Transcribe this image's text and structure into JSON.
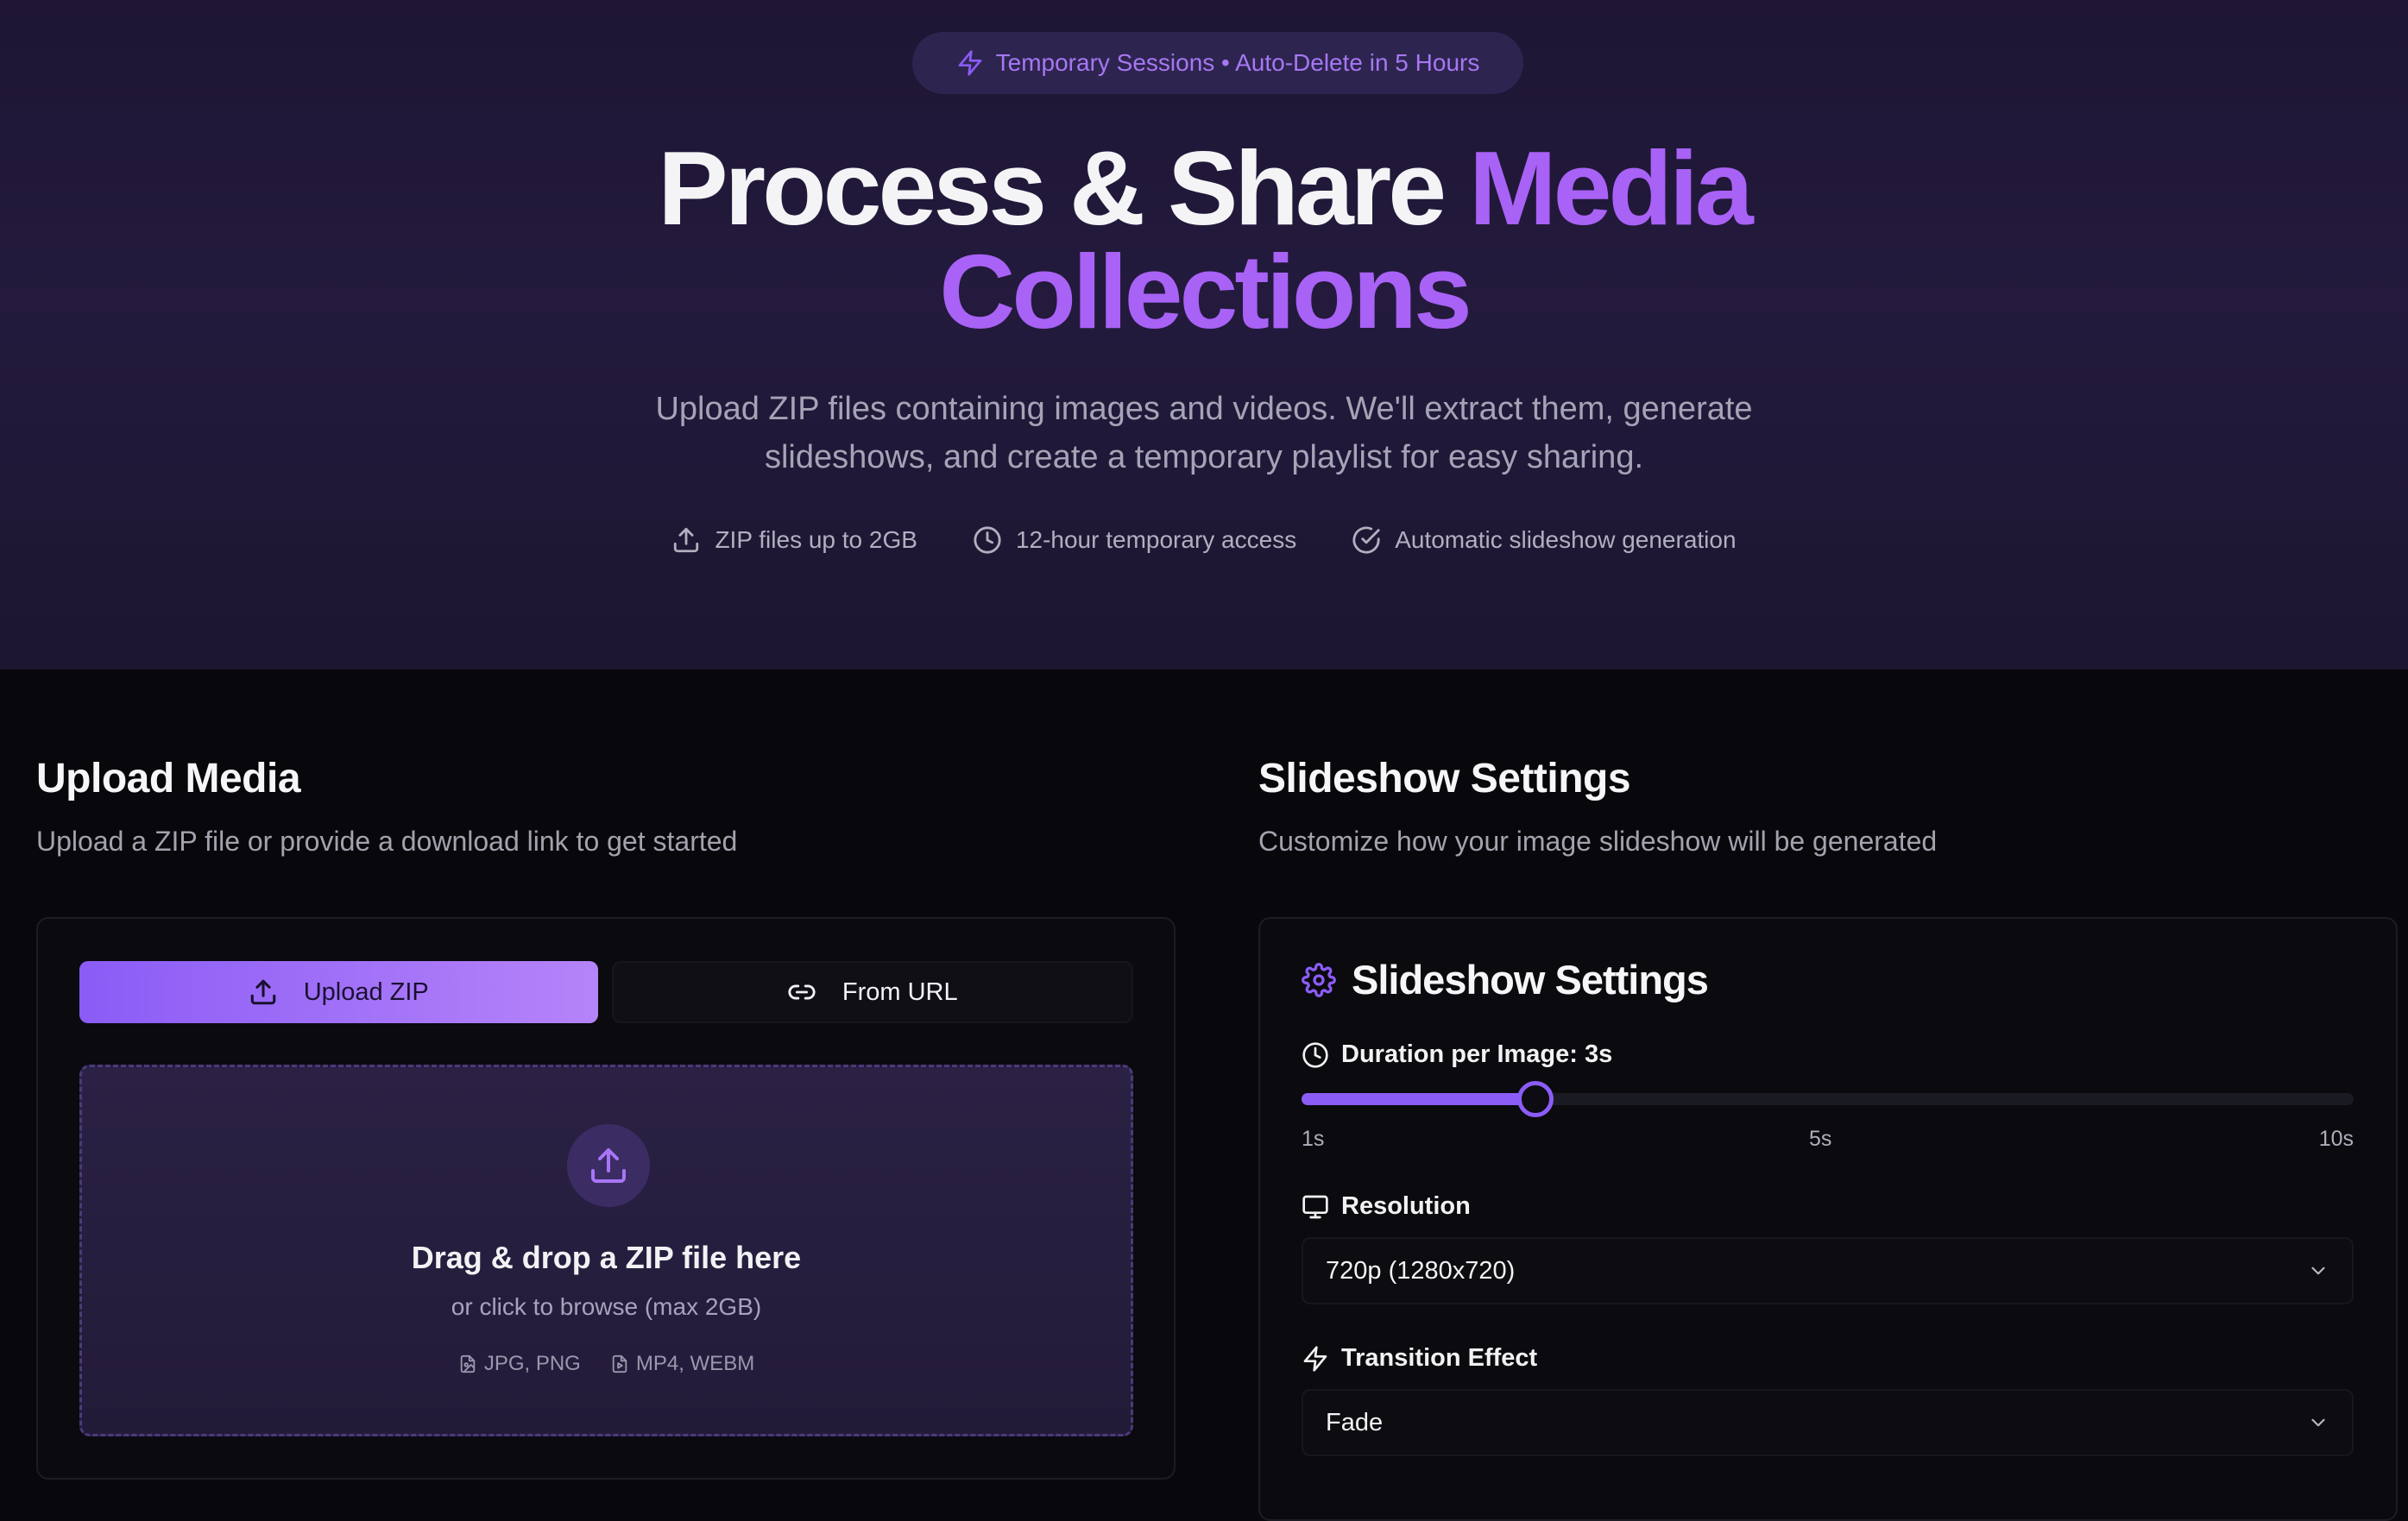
{
  "hero": {
    "badge": "Temporary Sessions • Auto-Delete in 5 Hours",
    "title_white": "Process & Share ",
    "title_purple_1": "Media",
    "title_purple_2": "Collections",
    "subtitle": "Upload ZIP files containing images and videos. We'll extract them, generate slideshows, and create a temporary playlist for easy sharing.",
    "features": [
      {
        "icon": "upload-icon",
        "label": "ZIP files up to 2GB"
      },
      {
        "icon": "clock-icon",
        "label": "12-hour temporary access"
      },
      {
        "icon": "check-circle-icon",
        "label": "Automatic slideshow generation"
      }
    ]
  },
  "upload": {
    "title": "Upload Media",
    "subtitle": "Upload a ZIP file or provide a download link to get started",
    "tabs": [
      {
        "icon": "upload-icon",
        "label": "Upload ZIP",
        "active": true
      },
      {
        "icon": "link-icon",
        "label": "From URL",
        "active": false
      }
    ],
    "dropzone": {
      "title": "Drag & drop a ZIP file here",
      "subtitle": "or click to browse (max 2GB)",
      "formats": [
        {
          "icon": "image-file-icon",
          "label": "JPG, PNG"
        },
        {
          "icon": "video-file-icon",
          "label": "MP4, WEBM"
        }
      ]
    }
  },
  "settings": {
    "title": "Slideshow Settings",
    "subtitle": "Customize how your image slideshow will be generated",
    "card_title": "Slideshow Settings",
    "duration": {
      "label": "Duration per Image: 3s",
      "min": 1,
      "max": 10,
      "value": 3,
      "ticks": [
        "1s",
        "5s",
        "10s"
      ]
    },
    "resolution": {
      "label": "Resolution",
      "value": "720p (1280x720)"
    },
    "transition": {
      "label": "Transition Effect",
      "value": "Fade"
    }
  },
  "colors": {
    "accent": "#8b5cf6",
    "accent_light": "#a862f5",
    "hero_bg": "#221a3b",
    "page_bg": "#08080c"
  }
}
